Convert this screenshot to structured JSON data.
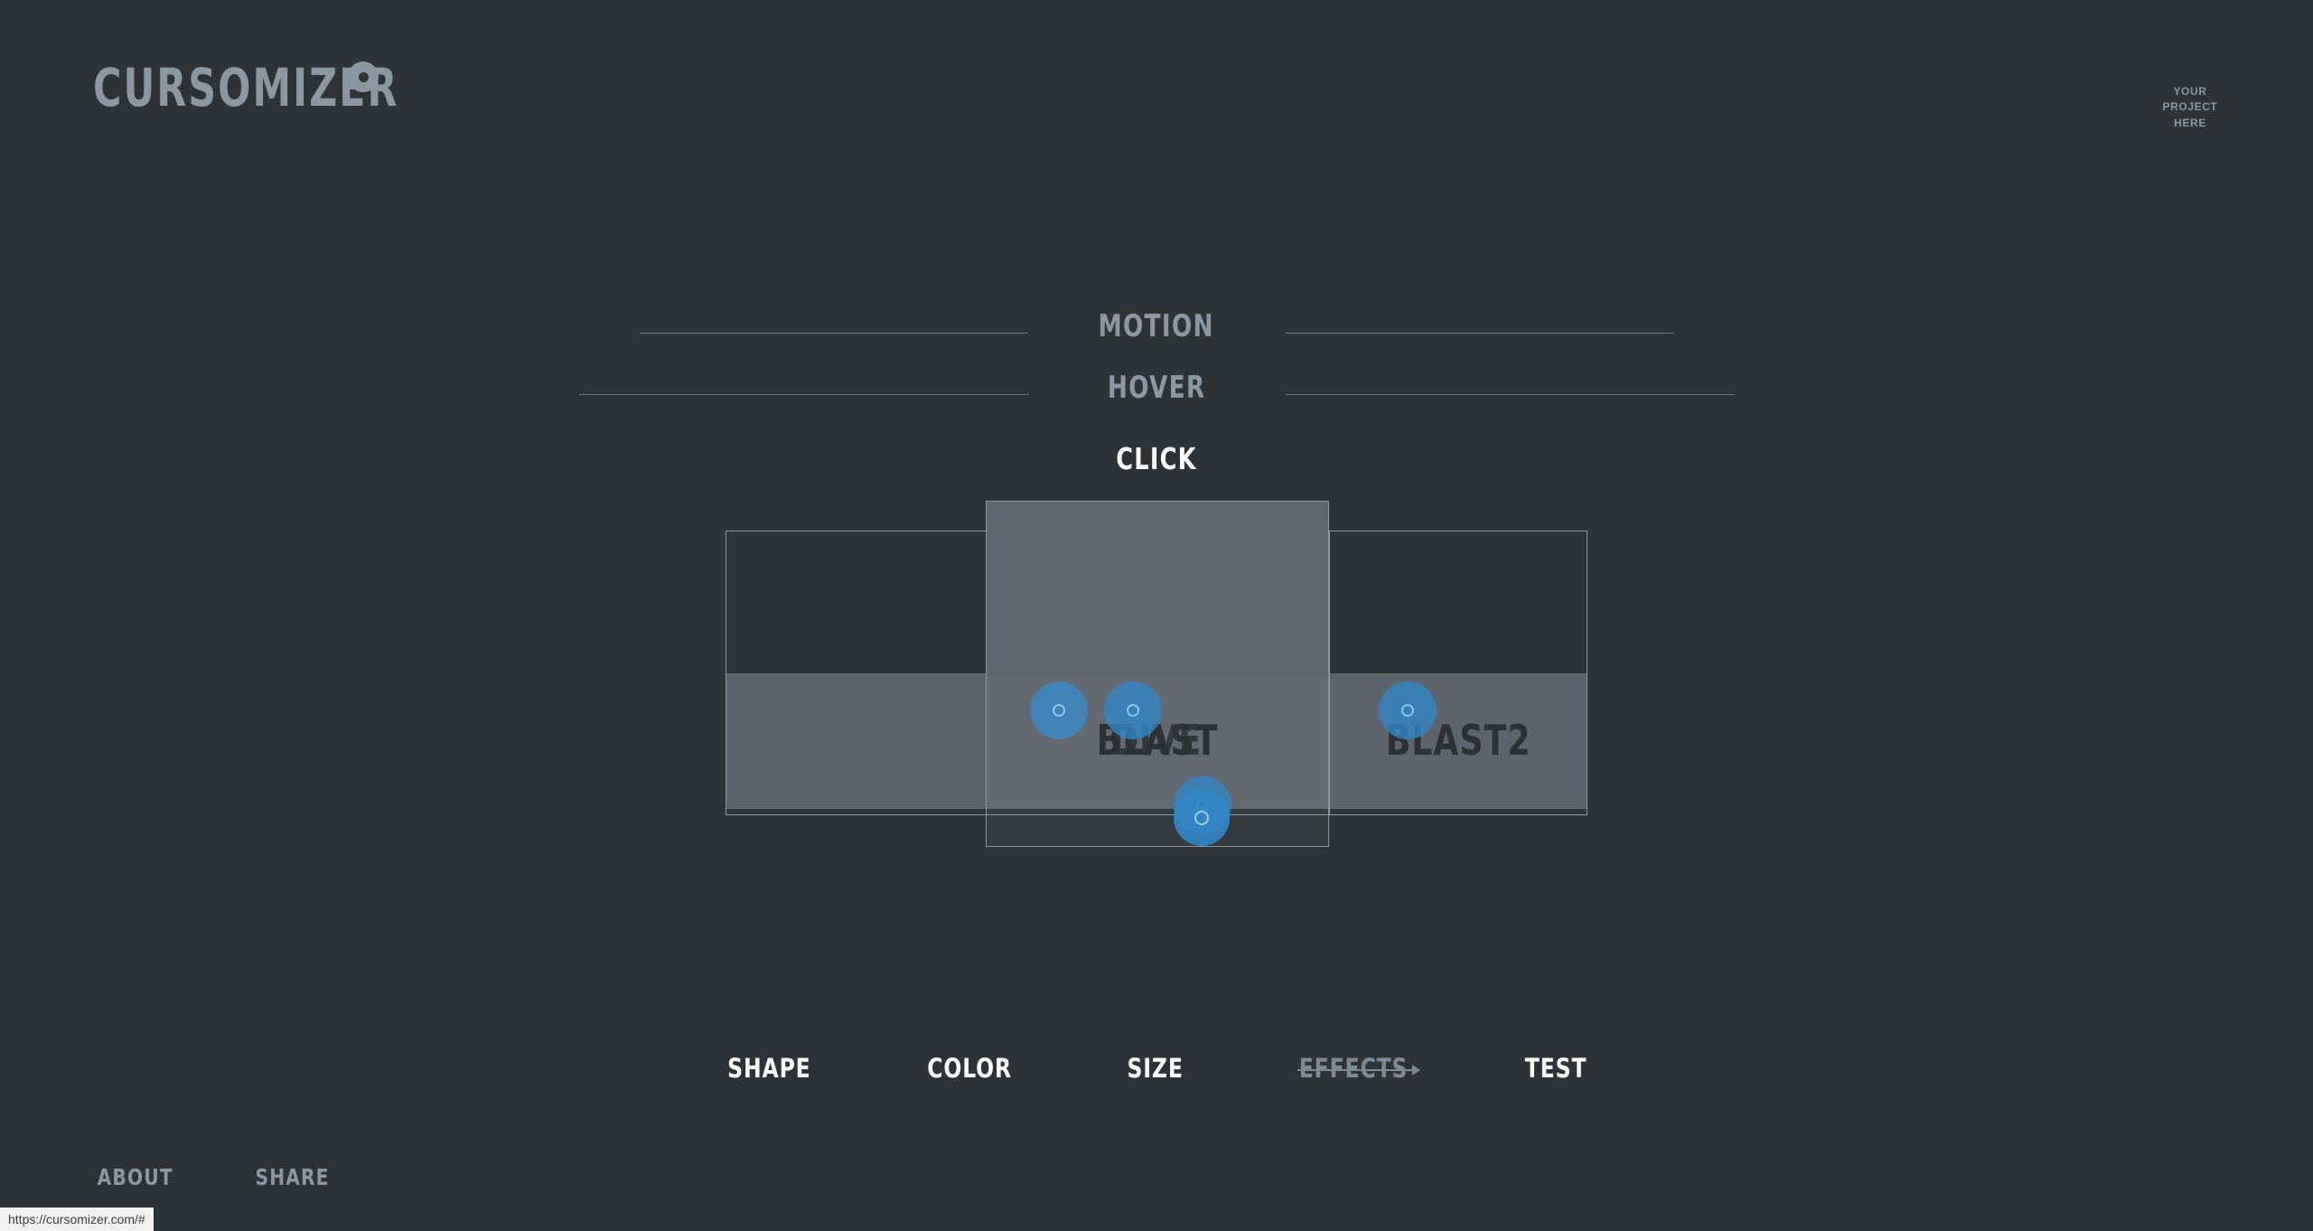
{
  "site": {
    "background_color": "#2e3337",
    "accent_color": "#3286c4",
    "muted_color": "#8b98a2"
  },
  "header": {
    "logo_text": "CURSOMIZER",
    "logo_icon": "cursor-dot-icon",
    "project_slot": "YOUR\nPROJECT\nHERE",
    "project_slot_line1": "YOUR",
    "project_slot_line2": "PROJECT",
    "project_slot_line3": "HERE"
  },
  "sections": [
    {
      "id": "motion",
      "label": "MOTION",
      "active": false
    },
    {
      "id": "hover",
      "label": "HOVER",
      "active": false
    },
    {
      "id": "click",
      "label": "CLICK",
      "active": true
    }
  ],
  "stage": {
    "panels": [
      {
        "id": "dive",
        "label": "DIVE",
        "selected": false
      },
      {
        "id": "blast",
        "label": "BLAST",
        "selected": true
      },
      {
        "id": "blast2",
        "label": "BLAST2",
        "selected": false
      }
    ]
  },
  "toolbar": {
    "items": [
      {
        "id": "shape",
        "label": "SHAPE",
        "disabled": false
      },
      {
        "id": "color",
        "label": "COLOR",
        "disabled": false
      },
      {
        "id": "size",
        "label": "SIZE",
        "disabled": false
      },
      {
        "id": "effects",
        "label": "EFFECTS",
        "disabled": true
      },
      {
        "id": "test",
        "label": "TEST",
        "disabled": false
      }
    ]
  },
  "footer": {
    "links": [
      {
        "id": "about",
        "label": "ABOUT"
      },
      {
        "id": "share",
        "label": "SHARE"
      }
    ]
  },
  "browser": {
    "status_url": "https://cursomizer.com/#"
  }
}
